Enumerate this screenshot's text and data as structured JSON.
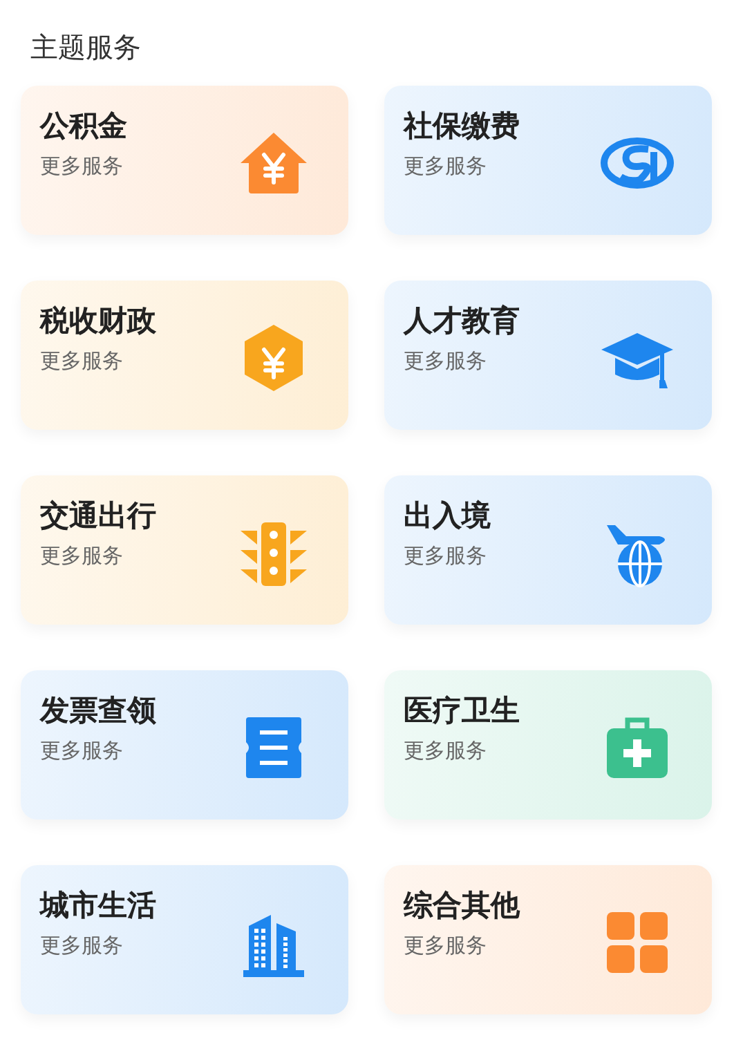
{
  "section": {
    "title": "主题服务"
  },
  "cards": [
    {
      "title": "公积金",
      "subtitle": "更多服务",
      "color": "#fb8a32"
    },
    {
      "title": "社保缴费",
      "subtitle": "更多服务",
      "color": "#1e86ee"
    },
    {
      "title": "税收财政",
      "subtitle": "更多服务",
      "color": "#f8a61e"
    },
    {
      "title": "人才教育",
      "subtitle": "更多服务",
      "color": "#1e86ee"
    },
    {
      "title": "交通出行",
      "subtitle": "更多服务",
      "color": "#f8a61e"
    },
    {
      "title": "出入境",
      "subtitle": "更多服务",
      "color": "#1e86ee"
    },
    {
      "title": "发票查领",
      "subtitle": "更多服务",
      "color": "#1e86ee"
    },
    {
      "title": "医疗卫生",
      "subtitle": "更多服务",
      "color": "#3cc08e"
    },
    {
      "title": "城市生活",
      "subtitle": "更多服务",
      "color": "#1e86ee"
    },
    {
      "title": "综合其他",
      "subtitle": "更多服务",
      "color": "#fb8a32"
    }
  ]
}
